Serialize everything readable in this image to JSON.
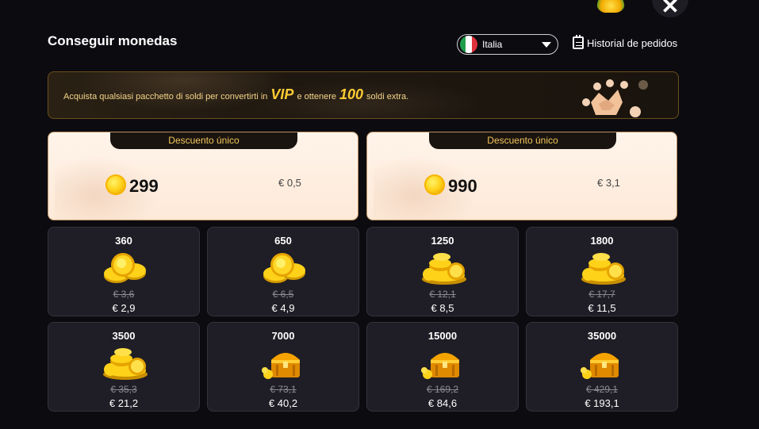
{
  "header": {
    "title": "Conseguir monedas",
    "country": {
      "selected": "Italia"
    },
    "history_label": "Historial de pedidos"
  },
  "vip_banner": {
    "text_before": "Acquista qualsiasi pacchetto di soldi per convertirti in",
    "vip": "VIP",
    "text_middle": "e ottenere",
    "bonus": "100",
    "text_after": "soldi extra."
  },
  "promos": [
    {
      "tag": "Descuento único",
      "amount": "299",
      "price": "€ 0,5"
    },
    {
      "tag": "Descuento único",
      "amount": "990",
      "price": "€ 3,1"
    }
  ],
  "packs": [
    {
      "amount": "360",
      "old_price": "€ 3,6",
      "price": "€ 2,9",
      "icon": "coin-stack-icon"
    },
    {
      "amount": "650",
      "old_price": "€ 6,5",
      "price": "€ 4,9",
      "icon": "coin-stack-icon"
    },
    {
      "amount": "1250",
      "old_price": "€ 12,1",
      "price": "€ 8,5",
      "icon": "coin-pile-icon"
    },
    {
      "amount": "1800",
      "old_price": "€ 17,7",
      "price": "€ 11,5",
      "icon": "coin-pile-icon"
    },
    {
      "amount": "3500",
      "old_price": "€ 35,3",
      "price": "€ 21,2",
      "icon": "coin-pile-icon"
    },
    {
      "amount": "7000",
      "old_price": "€ 73,1",
      "price": "€ 40,2",
      "icon": "treasure-chest-icon"
    },
    {
      "amount": "15000",
      "old_price": "€ 169,2",
      "price": "€ 84,6",
      "icon": "treasure-chest-icon"
    },
    {
      "amount": "35000",
      "old_price": "€ 429,1",
      "price": "€ 193,1",
      "icon": "treasure-chest-icon"
    }
  ],
  "colors": {
    "accent": "#ffcc33",
    "background": "#0c0b10",
    "card": "#1f1e26"
  }
}
